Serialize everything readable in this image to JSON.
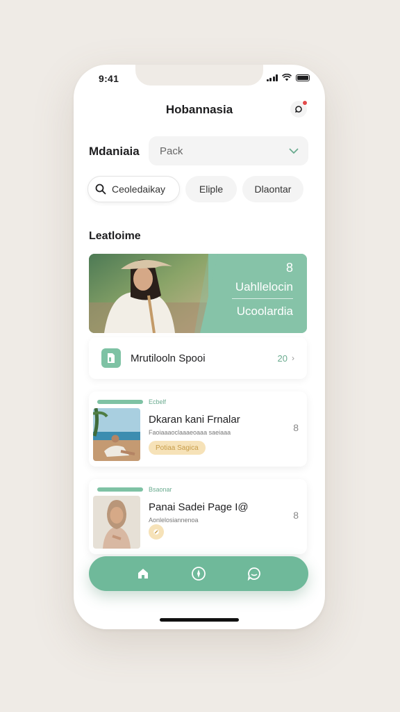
{
  "status_bar": {
    "time": "9:41"
  },
  "header": {
    "title": "Hobannasia"
  },
  "select": {
    "label": "Mdaniaia",
    "value": "Pack"
  },
  "chips": [
    {
      "label": "Ceoledaikay"
    },
    {
      "label": "Eliple"
    },
    {
      "label": "Dlaontar"
    }
  ],
  "section": {
    "title": "Leatloime"
  },
  "hero": {
    "number": "8",
    "line1": "Uahllelocin",
    "line2": "Ucoolardia"
  },
  "list_row": {
    "label": "Mrutilooln Spooi",
    "count": "20"
  },
  "items": [
    {
      "tag": "Ecbelf",
      "title": "Dkaran kani Frnalar",
      "subtitle": "Faoiaaaoclaaaeoaaa saeiaaa",
      "badge": "Potiaa Sagica",
      "more": "8"
    },
    {
      "tag": "Bsaonar",
      "title": "Panai Sadei Page I@",
      "subtitle": "Aonlelosiannenoa",
      "more": "8"
    }
  ],
  "colors": {
    "accent": "#6fb99a",
    "accent_light": "#86c3a8",
    "badge_bg": "#f6e2b8",
    "notification": "#e24b4b"
  }
}
